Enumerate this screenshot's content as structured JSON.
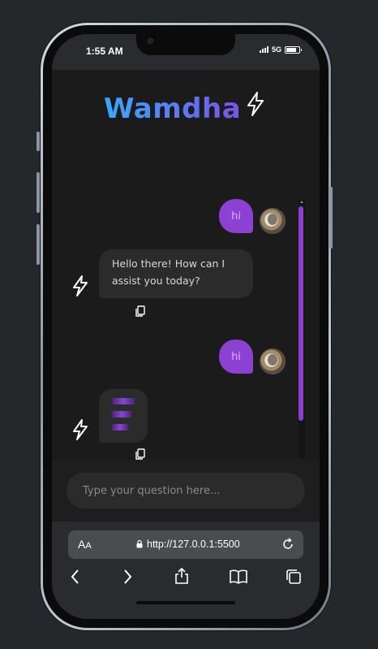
{
  "status_bar": {
    "time": "1:55 AM",
    "network": "5G"
  },
  "app": {
    "brand": "Wamdha"
  },
  "messages": [
    {
      "role": "user",
      "text": "hi"
    },
    {
      "role": "bot",
      "text_line1": "Hello there! How can I",
      "text_line2": "assist you today?"
    },
    {
      "role": "user",
      "text": "hi"
    },
    {
      "role": "bot",
      "state": "loading"
    }
  ],
  "composer": {
    "placeholder": "Type your question here..."
  },
  "browser": {
    "aa_label": "A",
    "aa_small": "A",
    "url": "http://127.0.0.1:5500"
  },
  "colors": {
    "accent": "#8c41d3",
    "brand_start": "#3aa8ff",
    "brand_end": "#7b53e6",
    "background": "#1b1b1c"
  }
}
